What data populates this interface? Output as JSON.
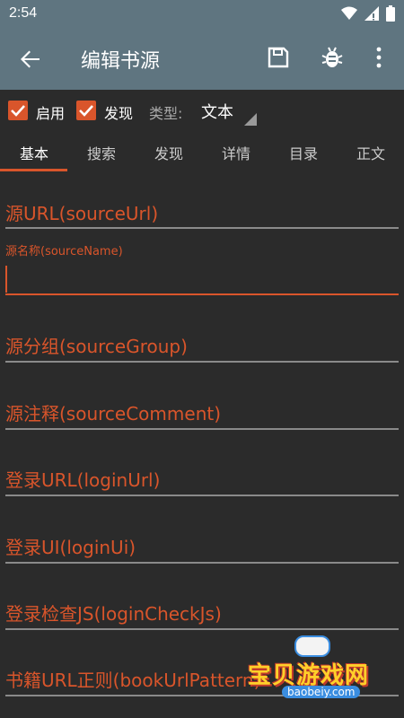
{
  "status_bar": {
    "time": "2:54",
    "icons": [
      "wifi-icon",
      "signal-icon",
      "battery-icon"
    ]
  },
  "app_bar": {
    "title": "编辑书源",
    "actions": [
      "back-arrow-icon",
      "save-icon",
      "bug-icon",
      "more-vert-icon"
    ]
  },
  "options": {
    "enable_label": "启用",
    "enable_checked": true,
    "discover_label": "发现",
    "discover_checked": true,
    "type_label": "类型:",
    "type_value": "文本"
  },
  "tabs": [
    {
      "label": "基本",
      "active": true
    },
    {
      "label": "搜索",
      "active": false
    },
    {
      "label": "发现",
      "active": false
    },
    {
      "label": "详情",
      "active": false
    },
    {
      "label": "目录",
      "active": false
    },
    {
      "label": "正文",
      "active": false
    }
  ],
  "fields": {
    "source_url": "源URL(sourceUrl)",
    "source_name": "源名称(sourceName)",
    "source_group": "源分组(sourceGroup)",
    "source_comment": "源注释(sourceComment)",
    "login_url": "登录URL(loginUrl)",
    "login_ui": "登录UI(loginUi)",
    "login_check_js": "登录检查JS(loginCheckJs)",
    "book_url_pattern": "书籍URL正则(bookUrlPattern)"
  },
  "watermark": {
    "text": "宝贝游戏网",
    "site": "baobeiy.com"
  },
  "colors": {
    "accent": "#d9552b",
    "app_bar": "#5f7580",
    "background": "#2b2b2b"
  }
}
